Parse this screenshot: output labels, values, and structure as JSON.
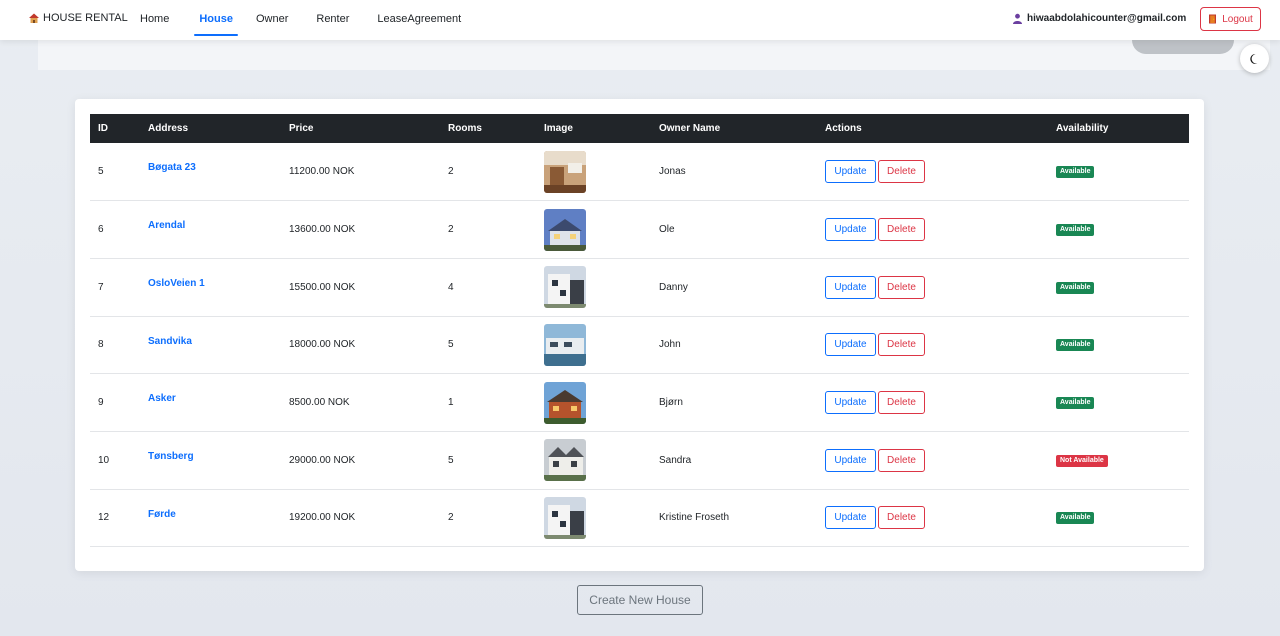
{
  "nav": {
    "brand": "HOUSE RENTAL",
    "links": [
      {
        "label": "Home"
      },
      {
        "label": "House",
        "active": true
      },
      {
        "label": "Owner"
      },
      {
        "label": "Renter"
      },
      {
        "label": "LeaseAgreement"
      }
    ],
    "user_email": "hiwaabdolahicounter@gmail.com",
    "logout_label": "Logout"
  },
  "table": {
    "headers": [
      "ID",
      "Address",
      "Price",
      "Rooms",
      "Image",
      "Owner Name",
      "Actions",
      "Availability"
    ],
    "rows": [
      {
        "id": "5",
        "address": "Bøgata 23",
        "price": "11200.00 NOK",
        "rooms": "2",
        "owner": "Jonas",
        "availability": "Available"
      },
      {
        "id": "6",
        "address": "Arendal",
        "price": "13600.00 NOK",
        "rooms": "2",
        "owner": "Ole",
        "availability": "Available"
      },
      {
        "id": "7",
        "address": "OsloVeien 1",
        "price": "15500.00 NOK",
        "rooms": "4",
        "owner": "Danny",
        "availability": "Available"
      },
      {
        "id": "8",
        "address": "Sandvika",
        "price": "18000.00 NOK",
        "rooms": "5",
        "owner": "John",
        "availability": "Available"
      },
      {
        "id": "9",
        "address": "Asker",
        "price": "8500.00 NOK",
        "rooms": "1",
        "owner": "Bjørn",
        "availability": "Available"
      },
      {
        "id": "10",
        "address": "Tønsberg",
        "price": "29000.00 NOK",
        "rooms": "5",
        "owner": "Sandra",
        "availability": "Not Available"
      },
      {
        "id": "12",
        "address": "Førde",
        "price": "19200.00 NOK",
        "rooms": "2",
        "owner": "Kristine Froseth",
        "availability": "Available"
      }
    ]
  },
  "actions": {
    "update_label": "Update",
    "delete_label": "Delete"
  },
  "create_label": "Create New House",
  "colors": {
    "primary": "#0d6efd",
    "danger": "#dc3545",
    "success": "#198754",
    "header_dark": "#212529"
  },
  "icons": {
    "brand": "house-icon",
    "user": "user-icon",
    "logout": "door-icon",
    "theme": "moon-icon"
  }
}
